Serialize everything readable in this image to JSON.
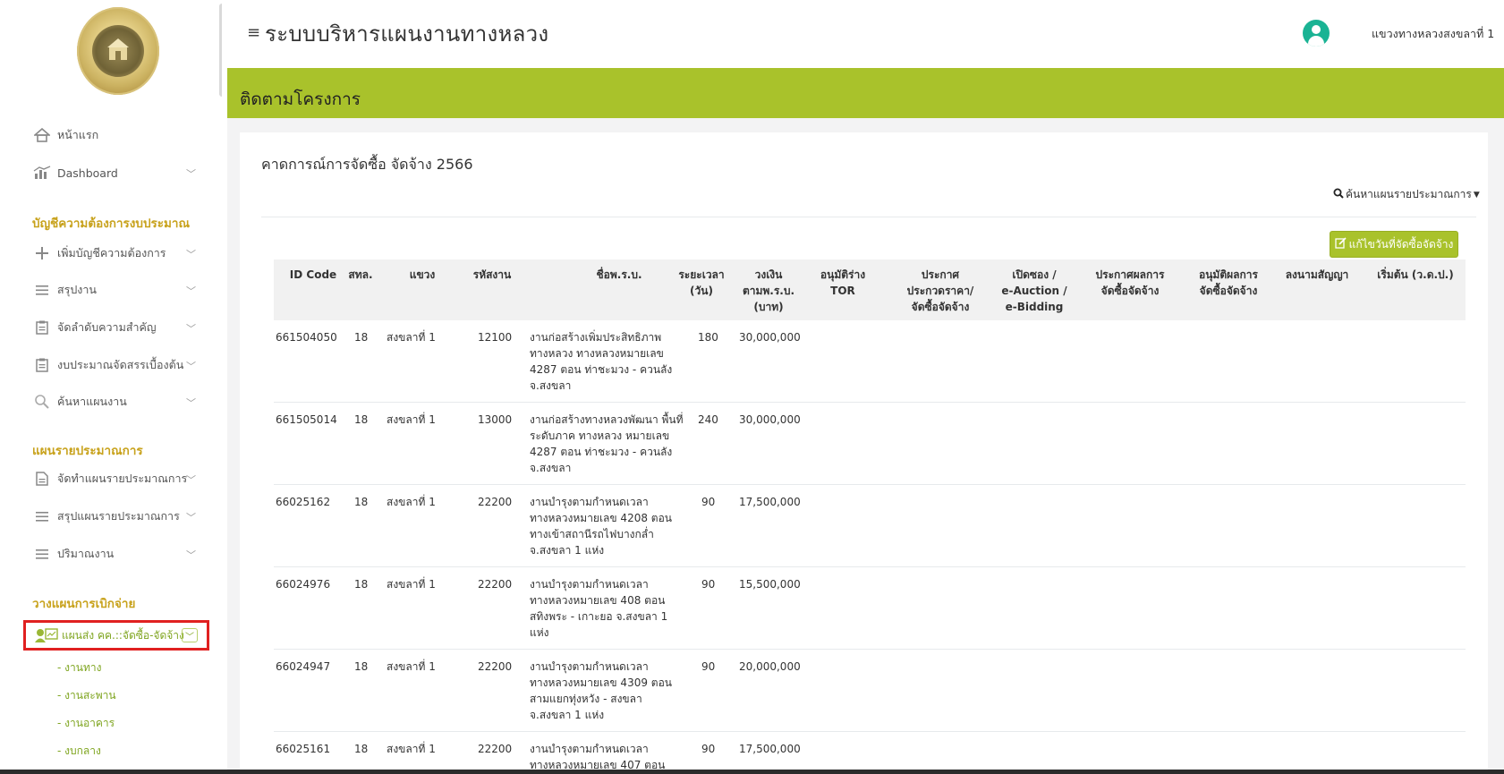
{
  "app": {
    "title": "ระบบบริหารแผนงานทางหลวง",
    "user_name": "แขวงทางหลวงสงขลาที่ 1"
  },
  "page": {
    "heading": "ติดตามโครงการ",
    "card_title": "คาดการณ์การจัดซื้อ จัดจ้าง 2566",
    "search_link": "ค้นหาแผนรายประมาณการ",
    "edit_button": "แก้ไขวันที่จัดซื้อจัดจ้าง"
  },
  "sidebar": {
    "home": "หน้าแรก",
    "dashboard": "Dashboard",
    "section1": "บัญชีความต้องการงบประมาณ",
    "add_need": "เพิ่มบัญชีความต้องการ",
    "summary": "สรุปงาน",
    "priority": "จัดลำดับความสำคัญ",
    "budget": "งบประมาณจัดสรรเบื้องต้น",
    "search_plan": "ค้นหาแผนงาน",
    "section2": "แผนรายประมาณการ",
    "make_plan": "จัดทำแผนรายประมาณการ",
    "sum_plan": "สรุปแผนรายประมาณการ",
    "quantity": "ปริมาณงาน",
    "section3": "วางแผนการเบิกจ่าย",
    "active": "แผนส่ง คค.::จัดซื้อ-จัดจ้าง",
    "sub1": "- งานทาง",
    "sub2": "- งานสะพาน",
    "sub3": "- งานอาคาร",
    "sub4": "- งบกลาง"
  },
  "table": {
    "headers": {
      "id": "ID Code",
      "sthl": "สทล.",
      "khwaeng": "แขวง",
      "code": "รหัสงาน",
      "name": "ชื่อพ.ร.บ.",
      "duration": [
        "ระยะเวลา",
        "(วัน)"
      ],
      "amount": [
        "วงเงิน",
        "ตามพ.ร.บ.",
        "(บาท)"
      ],
      "tor": "อนุมัติร่าง TOR",
      "announce": [
        "ประกาศ",
        "ประกวดราคา/",
        "จัดซื้อจัดจ้าง"
      ],
      "open": [
        "เปิดซอง /",
        "e-Auction /",
        "e-Bidding"
      ],
      "result": [
        "ประกาศผลการ",
        "จัดซื้อจัดจ้าง"
      ],
      "approve": [
        "อนุมัติผลการ",
        "จัดซื้อจัดจ้าง"
      ],
      "sign": "ลงนามสัญญา",
      "start": "เริ่มต้น (ว.ด.ป.)"
    },
    "rows": [
      {
        "id": "661504050",
        "sthl": "18",
        "khwaeng": "สงขลาที่ 1",
        "code": "12100",
        "name": "งานก่อสร้างเพิ่มประสิทธิภาพ ทางหลวง ทางหลวงหมายเลข 4287 ตอน ท่าชะมวง - ควนลัง จ.สงขลา",
        "duration": "180",
        "amount": "30,000,000"
      },
      {
        "id": "661505014",
        "sthl": "18",
        "khwaeng": "สงขลาที่ 1",
        "code": "13000",
        "name": "งานก่อสร้างทางหลวงพัฒนา พื้นที่ระดับภาค ทางหลวง หมายเลข 4287 ตอน ท่าชะมวง - ควนลัง จ.สงขลา",
        "duration": "240",
        "amount": "30,000,000"
      },
      {
        "id": "66025162",
        "sthl": "18",
        "khwaeng": "สงขลาที่ 1",
        "code": "22200",
        "name": "งานบำรุงตามกำหนดเวลา ทางหลวงหมายเลข 4208 ตอน ทางเข้าสถานีรถไฟบางกล่ำ จ.สงขลา 1 แห่ง",
        "duration": "90",
        "amount": "17,500,000"
      },
      {
        "id": "66024976",
        "sthl": "18",
        "khwaeng": "สงขลาที่ 1",
        "code": "22200",
        "name": "งานบำรุงตามกำหนดเวลา ทางหลวงหมายเลข 408 ตอน สทิงพระ - เกาะยอ จ.สงขลา 1 แห่ง",
        "duration": "90",
        "amount": "15,500,000"
      },
      {
        "id": "66024947",
        "sthl": "18",
        "khwaeng": "สงขลาที่ 1",
        "code": "22200",
        "name": "งานบำรุงตามกำหนดเวลา ทางหลวงหมายเลข 4309 ตอน สามแยกทุ่งหวัง - สงขลา จ.สงขลา 1 แห่ง",
        "duration": "90",
        "amount": "20,000,000"
      },
      {
        "id": "66025161",
        "sthl": "18",
        "khwaeng": "สงขลาที่ 1",
        "code": "22200",
        "name": "งานบำรุงตามกำหนดเวลา ทางหลวงหมายเลข 407 ตอน",
        "duration": "90",
        "amount": "17,500,000"
      }
    ]
  },
  "colors": {
    "accent_green": "#a9c22b",
    "section_gold": "#c8a21c",
    "highlight_red": "#e02020"
  }
}
